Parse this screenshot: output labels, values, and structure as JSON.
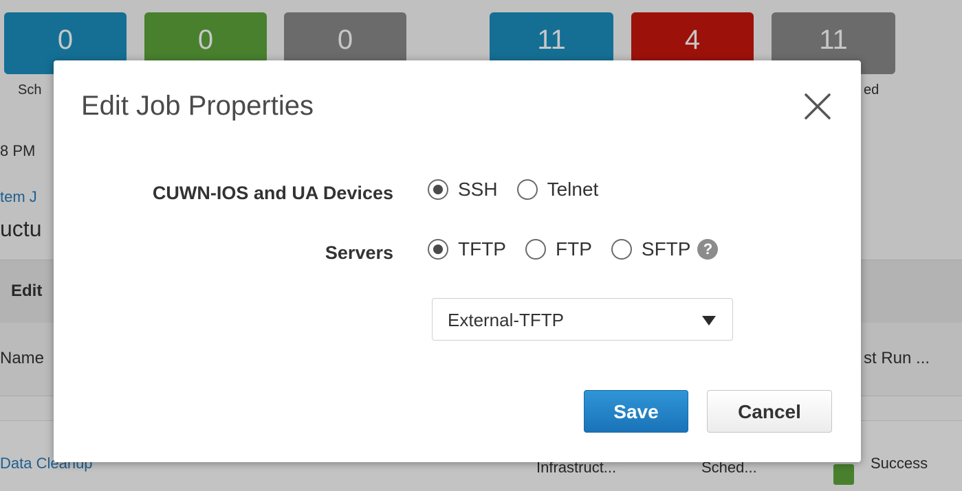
{
  "background": {
    "tiles": [
      {
        "value": "0",
        "color": "#1c8fbe"
      },
      {
        "value": "0",
        "color": "#5da43c"
      },
      {
        "value": "0",
        "color": "#8a8a8a"
      },
      {
        "value": "11",
        "color": "#1c8fbe"
      },
      {
        "value": "4",
        "color": "#c8180f"
      },
      {
        "value": "11",
        "color": "#8a8a8a"
      }
    ],
    "label_sch": "Sch",
    "label_ed": "ed",
    "time_text": "8 PM",
    "system_link": "tem J",
    "infra_heading": "uctu",
    "toolbar_edit": "Edit",
    "col_name": "Name",
    "col_last_run": "st Run ...",
    "row_name": "Data Cleanup",
    "row_category": "Infrastruct...",
    "row_schedule": "Sched...",
    "row_status": "Success"
  },
  "modal": {
    "title": "Edit Job Properties",
    "close_icon": "close-x-icon",
    "devices_label": "CUWN-IOS and UA Devices",
    "devices_options": [
      {
        "label": "SSH",
        "checked": true
      },
      {
        "label": "Telnet",
        "checked": false
      }
    ],
    "servers_label": "Servers",
    "servers_options": [
      {
        "label": "TFTP",
        "checked": true
      },
      {
        "label": "FTP",
        "checked": false
      },
      {
        "label": "SFTP",
        "checked": false
      }
    ],
    "help_icon": "?",
    "server_select": {
      "value": "External-TFTP"
    },
    "save_label": "Save",
    "cancel_label": "Cancel",
    "accent_color": "#1a73b8"
  }
}
